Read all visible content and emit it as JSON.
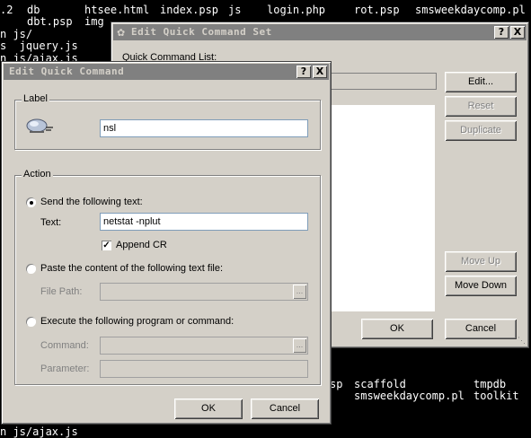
{
  "terminal": {
    "line0": [
      ".2",
      "db",
      "htsee.html",
      "index.psp",
      "js",
      "login.php",
      "rot.psp",
      "smsweekdaycomp.pl"
    ],
    "line1": [
      "dbt.psp",
      "img"
    ],
    "line2": "n js/",
    "line3": "s  jquery.js",
    "line4": "n js/ajax.js",
    "bottom1": [
      "sp",
      "scaffold",
      "tmpdb"
    ],
    "bottom2": [
      "smsweekdaycomp.pl",
      "toolkit"
    ],
    "bottom3": "n js/ajax.js"
  },
  "back_dialog": {
    "title": "Edit Quick Command Set",
    "help": "?",
    "close": "X",
    "list_label": "Quick Command List:",
    "buttons": {
      "edit": "Edit...",
      "reset": "Reset",
      "duplicate": "Duplicate",
      "move_up": "Move Up",
      "move_down": "Move Down",
      "ok": "OK",
      "cancel": "Cancel"
    }
  },
  "front_dialog": {
    "title": "Edit Quick Command",
    "help": "?",
    "close": "X",
    "label_group": "Label",
    "label_value": "nsl",
    "action_group": "Action",
    "send_text_option": "Send the following text:",
    "text_label": "Text:",
    "text_value": "netstat -nplut",
    "append_cr": "Append CR",
    "paste_option": "Paste the content of the following text file:",
    "file_path_label": "File Path:",
    "execute_option": "Execute the following program or command:",
    "command_label": "Command:",
    "parameter_label": "Parameter:",
    "browse": "...",
    "ok": "OK",
    "cancel": "Cancel"
  },
  "colors": {
    "active_title": "#0a246a",
    "inactive_title": "#808080",
    "dialog_bg": "#d4d0c8"
  }
}
